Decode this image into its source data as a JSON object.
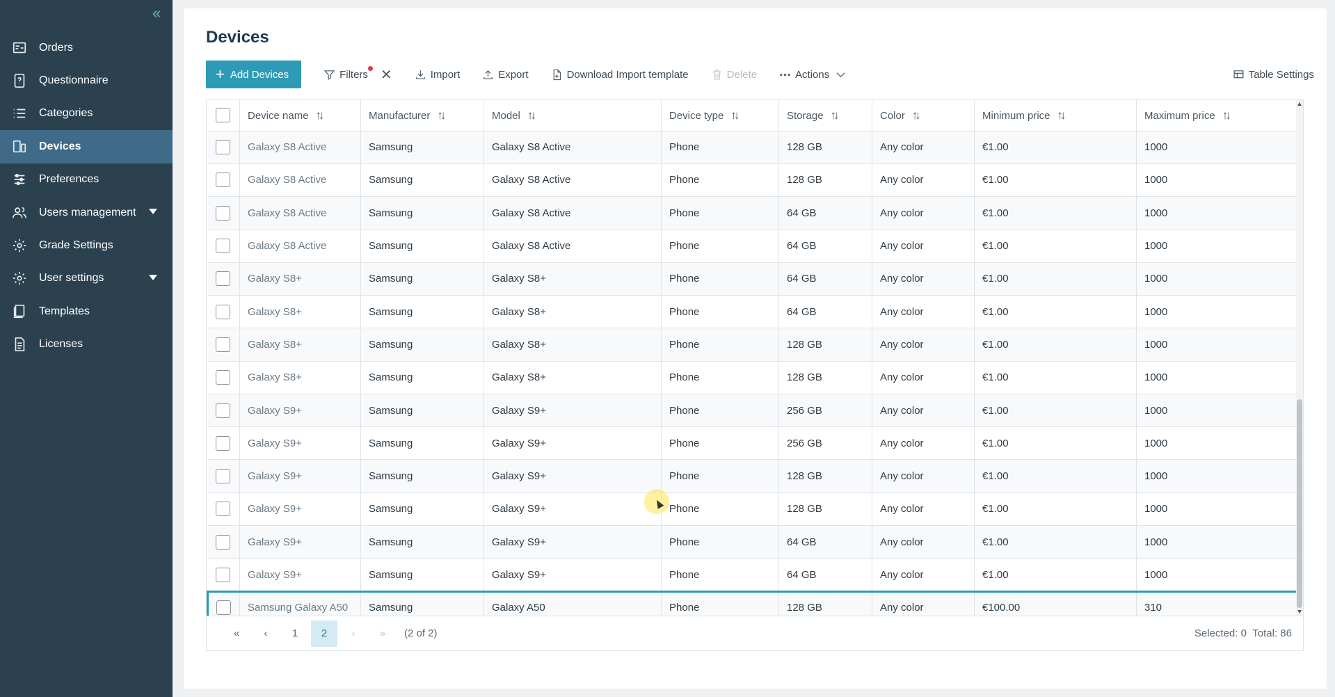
{
  "sidebar": {
    "items": [
      {
        "label": "Orders",
        "icon": "orders-icon",
        "active": false
      },
      {
        "label": "Questionnaire",
        "icon": "questionnaire-icon",
        "active": false
      },
      {
        "label": "Categories",
        "icon": "list-icon",
        "active": false
      },
      {
        "label": "Devices",
        "icon": "devices-icon",
        "active": true
      },
      {
        "label": "Preferences",
        "icon": "sliders-icon",
        "active": false
      },
      {
        "label": "Users management",
        "icon": "users-icon",
        "active": false,
        "expandable": true
      },
      {
        "label": "Grade Settings",
        "icon": "gear-icon",
        "active": false
      },
      {
        "label": "User settings",
        "icon": "gear-icon",
        "active": false,
        "expandable": true
      },
      {
        "label": "Templates",
        "icon": "templates-icon",
        "active": false
      },
      {
        "label": "Licenses",
        "icon": "document-icon",
        "active": false
      }
    ]
  },
  "page": {
    "title": "Devices"
  },
  "toolbar": {
    "add": "Add Devices",
    "filters": "Filters",
    "import": "Import",
    "export": "Export",
    "download_template": "Download Import template",
    "delete": "Delete",
    "actions": "Actions",
    "table_settings": "Table Settings"
  },
  "table": {
    "columns": [
      "Device name",
      "Manufacturer",
      "Model",
      "Device type",
      "Storage",
      "Color",
      "Minimum price",
      "Maximum price"
    ],
    "rows": [
      [
        "Galaxy S8 Active",
        "Samsung",
        "Galaxy S8 Active",
        "Phone",
        "128 GB",
        "Any color",
        "€1.00",
        "1000"
      ],
      [
        "Galaxy S8 Active",
        "Samsung",
        "Galaxy S8 Active",
        "Phone",
        "128 GB",
        "Any color",
        "€1.00",
        "1000"
      ],
      [
        "Galaxy S8 Active",
        "Samsung",
        "Galaxy S8 Active",
        "Phone",
        "64 GB",
        "Any color",
        "€1.00",
        "1000"
      ],
      [
        "Galaxy S8 Active",
        "Samsung",
        "Galaxy S8 Active",
        "Phone",
        "64 GB",
        "Any color",
        "€1.00",
        "1000"
      ],
      [
        "Galaxy S8+",
        "Samsung",
        "Galaxy S8+",
        "Phone",
        "64 GB",
        "Any color",
        "€1.00",
        "1000"
      ],
      [
        "Galaxy S8+",
        "Samsung",
        "Galaxy S8+",
        "Phone",
        "64 GB",
        "Any color",
        "€1.00",
        "1000"
      ],
      [
        "Galaxy S8+",
        "Samsung",
        "Galaxy S8+",
        "Phone",
        "128 GB",
        "Any color",
        "€1.00",
        "1000"
      ],
      [
        "Galaxy S8+",
        "Samsung",
        "Galaxy S8+",
        "Phone",
        "128 GB",
        "Any color",
        "€1.00",
        "1000"
      ],
      [
        "Galaxy S9+",
        "Samsung",
        "Galaxy S9+",
        "Phone",
        "256 GB",
        "Any color",
        "€1.00",
        "1000"
      ],
      [
        "Galaxy S9+",
        "Samsung",
        "Galaxy S9+",
        "Phone",
        "256 GB",
        "Any color",
        "€1.00",
        "1000"
      ],
      [
        "Galaxy S9+",
        "Samsung",
        "Galaxy S9+",
        "Phone",
        "128 GB",
        "Any color",
        "€1.00",
        "1000"
      ],
      [
        "Galaxy S9+",
        "Samsung",
        "Galaxy S9+",
        "Phone",
        "128 GB",
        "Any color",
        "€1.00",
        "1000"
      ],
      [
        "Galaxy S9+",
        "Samsung",
        "Galaxy S9+",
        "Phone",
        "64 GB",
        "Any color",
        "€1.00",
        "1000"
      ],
      [
        "Galaxy S9+",
        "Samsung",
        "Galaxy S9+",
        "Phone",
        "64 GB",
        "Any color",
        "€1.00",
        "1000"
      ],
      [
        "Samsung Galaxy A50",
        "Samsung",
        "Galaxy A50",
        "Phone",
        "128 GB",
        "Any color",
        "€100.00",
        "310"
      ]
    ],
    "highlighted_row": 14
  },
  "pagination": {
    "pages": [
      "1",
      "2"
    ],
    "current": "2",
    "info": "(2 of 2)",
    "selected": "Selected: 0",
    "total": "Total: 86"
  },
  "colors": {
    "sidebar": "#2c4150",
    "active": "#3f6b88",
    "accent": "#2d9ab7"
  }
}
